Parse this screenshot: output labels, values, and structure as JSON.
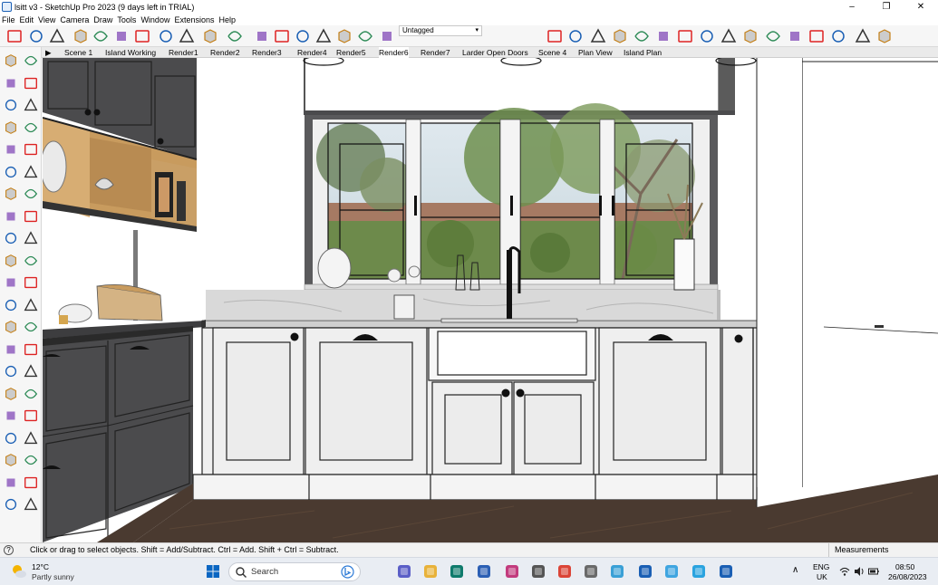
{
  "window": {
    "title": "lsitt v3 - SketchUp Pro 2023 (9 days left in TRIAL)",
    "minimize_glyph": "–",
    "maximize_glyph": "❐",
    "close_glyph": "✕"
  },
  "menu": [
    "File",
    "Edit",
    "View",
    "Camera",
    "Draw",
    "Tools",
    "Window",
    "Extensions",
    "Help"
  ],
  "toolbar": {
    "tag_select_value": "Untagged",
    "icons": [
      "new-icon",
      "open-icon",
      "save-icon",
      "cut-icon",
      "copy-icon",
      "paste-icon",
      "erase-icon",
      "undo-icon",
      "redo-icon",
      "print-icon",
      "model-info-icon",
      "iso-view-icon",
      "top-view-icon",
      "front-view-icon",
      "right-view-icon",
      "back-view-icon",
      "left-view-icon",
      "xray-icon",
      "back-edges-icon",
      "wireframe-icon",
      "hidden-line-icon",
      "shaded-icon",
      "shaded-textures-icon",
      "monochrome-icon",
      "extension-warehouse-icon",
      "3d-warehouse-icon",
      "extension-manager-icon",
      "layout-icon",
      "section-plane-icon",
      "section-display-icon",
      "section-cuts-icon",
      "section-fill-icon",
      "solid-tools-icon",
      "sandbox-icon"
    ]
  },
  "scenes": [
    {
      "label": "Scene 1",
      "active": false
    },
    {
      "label": "Island Working",
      "active": false
    },
    {
      "label": "Render1",
      "active": false
    },
    {
      "label": "Render2",
      "active": false
    },
    {
      "label": "Render3",
      "active": false
    },
    {
      "label": "Render4",
      "active": false
    },
    {
      "label": "Render5",
      "active": false
    },
    {
      "label": "Render6",
      "active": true
    },
    {
      "label": "Render7",
      "active": false
    },
    {
      "label": "Larder Open Doors",
      "active": false
    },
    {
      "label": "Scene 4",
      "active": false
    },
    {
      "label": "Plan View",
      "active": false
    },
    {
      "label": "Island Plan",
      "active": false
    }
  ],
  "tools": [
    "select-icon",
    "orbit-icon",
    "paint-bucket-icon",
    "eraser-icon",
    "component-icon",
    "tape-measure-icon",
    "pencil-line-icon",
    "freehand-icon",
    "rectangle-icon",
    "rotated-rectangle-icon",
    "circle-icon",
    "polygon-icon",
    "arc-icon",
    "pie-icon",
    "two-point-arc-icon",
    "three-point-arc-icon",
    "move-icon",
    "push-pull-icon",
    "rotate-icon",
    "follow-me-icon",
    "scale-icon",
    "offset-icon",
    "axes-icon",
    "dimension-icon",
    "protractor-icon",
    "text-icon",
    "tape-measure-2-icon",
    "3d-text-icon",
    "orbit-2-icon",
    "pan-icon",
    "zoom-icon",
    "zoom-window-icon",
    "zoom-extents-icon",
    "previous-view-icon",
    "position-camera-icon",
    "walk-icon",
    "look-around-icon",
    "section-plane-icon",
    "sandbox-icon",
    "sandbox-smoove-icon",
    "stamp-icon",
    "drape-icon"
  ],
  "status": {
    "info_glyph": "?",
    "hint": "Click or drag to select objects. Shift = Add/Subtract. Ctrl = Add. Shift + Ctrl = Subtract.",
    "measurements_label": "Measurements"
  },
  "taskbar": {
    "weather_temp": "12°C",
    "weather_desc": "Partly sunny",
    "search_label": "Search",
    "apps": [
      "start-icon",
      "search-icon",
      "bing-icon",
      "teams-chat-icon",
      "file-explorer-icon",
      "edge-icon",
      "store-icon",
      "snipping-tool-icon",
      "settings-icon",
      "chrome-icon",
      "calculator-icon",
      "photos-icon",
      "mail-icon",
      "notepad-icon",
      "telegram-icon",
      "sketchup-icon"
    ],
    "tray_chevron": "∧",
    "lang_line1": "ENG",
    "lang_line2": "UK",
    "time": "08:50",
    "date": "26/08/2023"
  },
  "colors": {
    "cabinet_dark": "#4b4b4d",
    "cabinet_white": "#efefef",
    "countertop": "#cfcfcf",
    "floor": "#4a3a30",
    "shelf_wood": "#c89b5e",
    "accent_blue": "#1a5fb4"
  }
}
